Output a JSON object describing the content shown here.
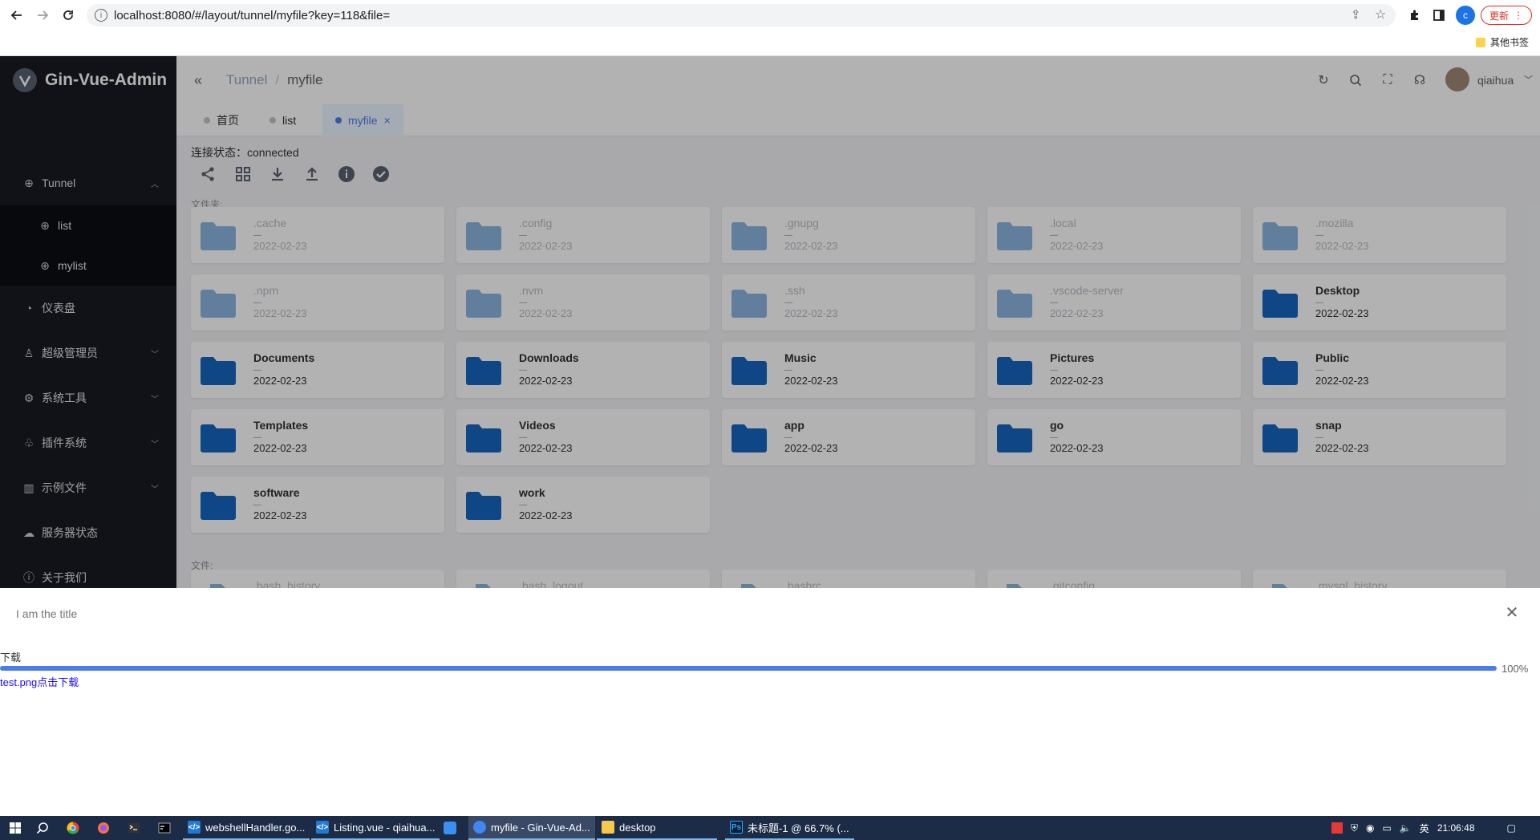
{
  "browser": {
    "url": "localhost:8080/#/layout/tunnel/myfile?key=118&file=",
    "update_label": "更新",
    "profile_letter": "c",
    "bookmarks_label": "其他书签"
  },
  "app": {
    "logo_text": "Gin-Vue-Admin",
    "sidebar": {
      "items": [
        {
          "label": "Tunnel"
        },
        {
          "label": "list"
        },
        {
          "label": "mylist"
        },
        {
          "label": "仪表盘"
        },
        {
          "label": "超级管理员"
        },
        {
          "label": "系统工具"
        },
        {
          "label": "插件系统"
        },
        {
          "label": "示例文件"
        },
        {
          "label": "服务器状态"
        },
        {
          "label": "关于我们"
        }
      ]
    },
    "breadcrumb": {
      "parent": "Tunnel",
      "sep": "/",
      "current": "myfile"
    },
    "user": {
      "name": "qiaihua"
    },
    "tabs": [
      {
        "label": "首页"
      },
      {
        "label": "list"
      },
      {
        "label": "myfile",
        "close": "×"
      }
    ],
    "connection": {
      "label": "连接状态：",
      "value": "connected"
    },
    "folders_label": "文件夹:",
    "files_label": "文件:",
    "folders": [
      {
        "name": ".cache",
        "date": "2022-02-23"
      },
      {
        "name": ".config",
        "date": "2022-02-23"
      },
      {
        "name": ".gnupg",
        "date": "2022-02-23"
      },
      {
        "name": ".local",
        "date": "2022-02-23"
      },
      {
        "name": ".mozilla",
        "date": "2022-02-23"
      },
      {
        "name": ".npm",
        "date": "2022-02-23"
      },
      {
        "name": ".nvm",
        "date": "2022-02-23"
      },
      {
        "name": ".ssh",
        "date": "2022-02-23"
      },
      {
        "name": ".vscode-server",
        "date": "2022-02-23"
      },
      {
        "name": "Desktop",
        "date": "2022-02-23"
      },
      {
        "name": "Documents",
        "date": "2022-02-23"
      },
      {
        "name": "Downloads",
        "date": "2022-02-23"
      },
      {
        "name": "Music",
        "date": "2022-02-23"
      },
      {
        "name": "Pictures",
        "date": "2022-02-23"
      },
      {
        "name": "Public",
        "date": "2022-02-23"
      },
      {
        "name": "Templates",
        "date": "2022-02-23"
      },
      {
        "name": "Videos",
        "date": "2022-02-23"
      },
      {
        "name": "app",
        "date": "2022-02-23"
      },
      {
        "name": "go",
        "date": "2022-02-23"
      },
      {
        "name": "snap",
        "date": "2022-02-23"
      },
      {
        "name": "software",
        "date": "2022-02-23"
      },
      {
        "name": "work",
        "date": "2022-02-23"
      }
    ],
    "files": [
      {
        "name": ".bash_history"
      },
      {
        "name": ".bash_logout"
      },
      {
        "name": ".bashrc"
      },
      {
        "name": ".gitconfig"
      },
      {
        "name": ".mysql_history"
      }
    ],
    "dash": "—"
  },
  "drawer": {
    "title": "I am the title",
    "close": "✕",
    "download_label": "下载",
    "progress_percent": 100,
    "progress_text": "100%",
    "link_text": "test.png点击下载"
  },
  "taskbar": {
    "apps": [
      {
        "label": "webshellHandler.go..."
      },
      {
        "label": "Listing.vue - qiaihua..."
      },
      {
        "label": "myfile - Gin-Vue-Ad..."
      },
      {
        "label": "desktop"
      },
      {
        "label": "未标题-1 @ 66.7% (..."
      }
    ],
    "tray_lang": "英",
    "tray_time": "21:06:48"
  },
  "colors": {
    "accent": "#4c7af1",
    "sidebar_bg": "#191a23",
    "folder_blue": "#1565c0"
  }
}
